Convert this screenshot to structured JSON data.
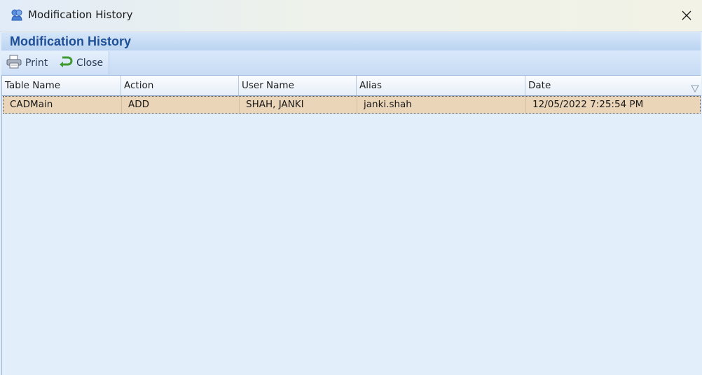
{
  "window": {
    "title": "Modification History",
    "close_glyph": "✕"
  },
  "header": {
    "title": "Modification History"
  },
  "toolbar": {
    "print_label": "Print",
    "close_label": "Close",
    "print_icon": "printer-icon",
    "close_icon": "close-arrow-icon"
  },
  "grid": {
    "columns": [
      "Table Name",
      "Action",
      "User Name",
      "Alias",
      "Date"
    ],
    "rows": [
      [
        "CADMain",
        "ADD",
        "SHAH, JANKI",
        "janki.shah",
        "12/05/2022 7:25:54 PM"
      ]
    ],
    "selected_row_color": "#ebd5b8"
  },
  "colors": {
    "accent": "#1f4f97",
    "background": "#e3eefb"
  }
}
